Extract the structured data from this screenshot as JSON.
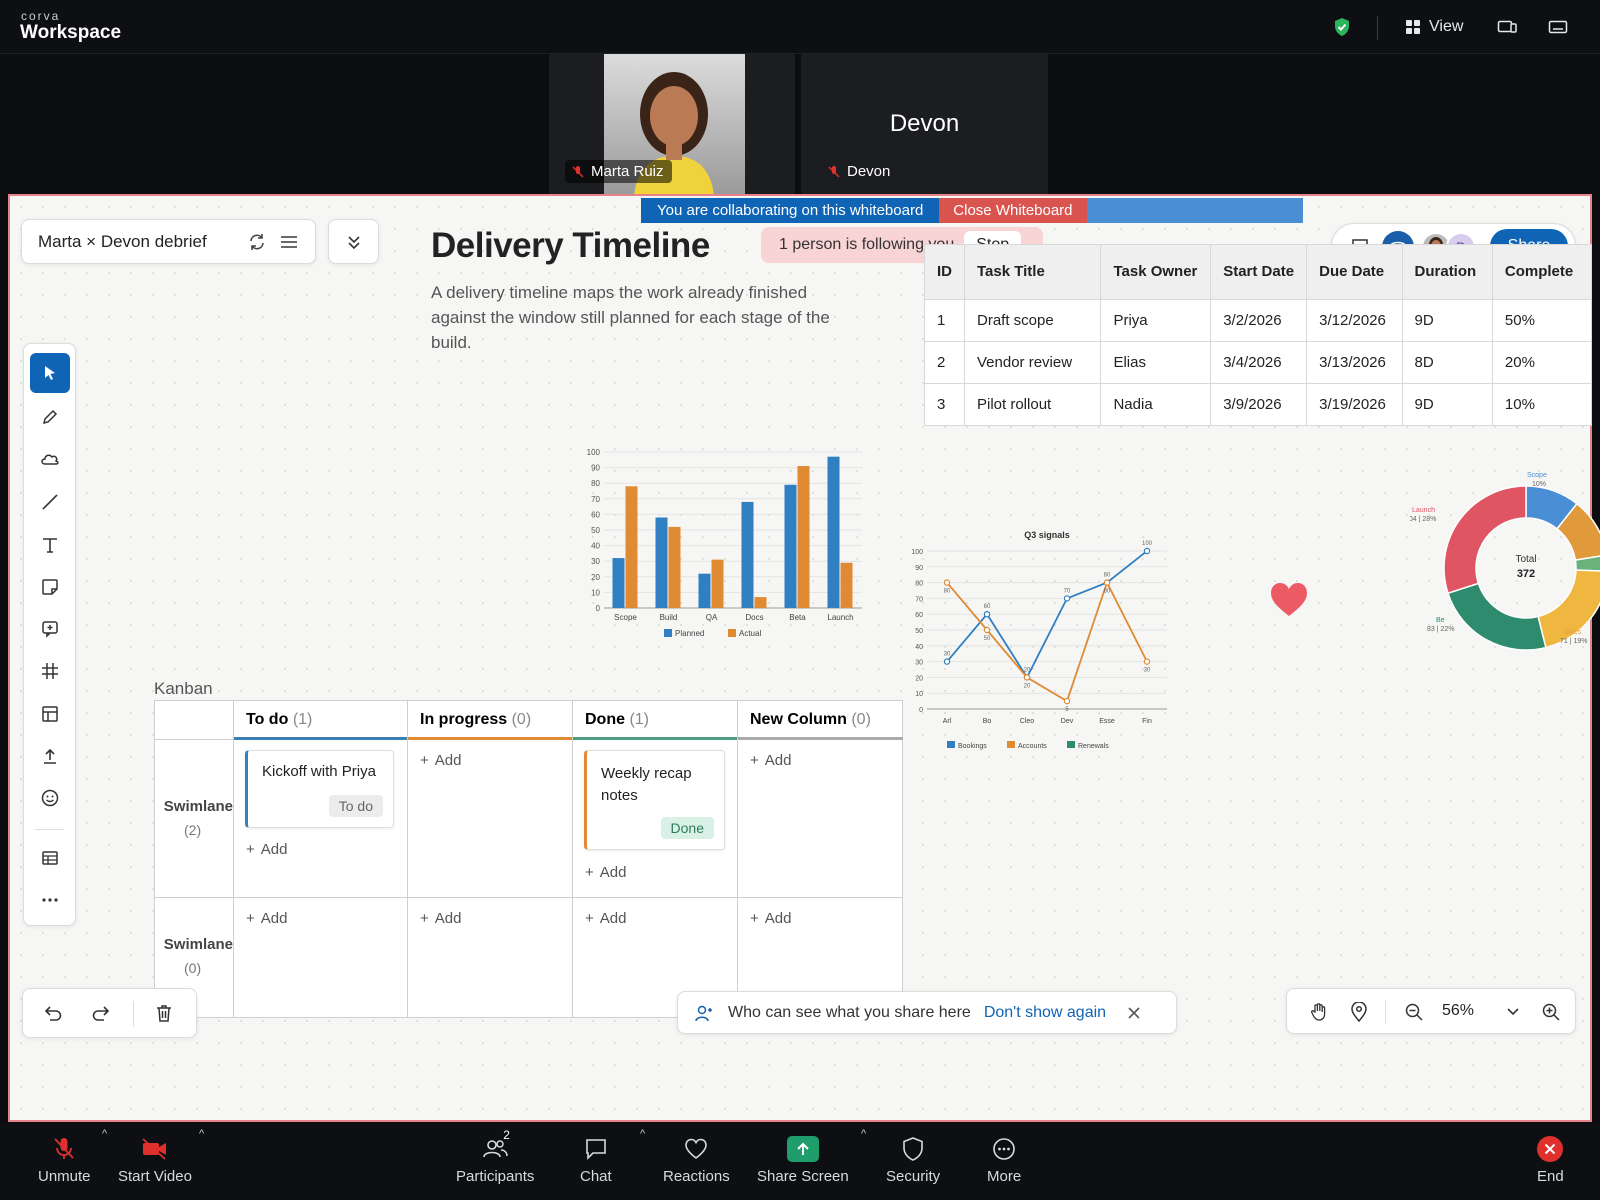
{
  "app": {
    "brand_small": "corva",
    "brand": "Workspace"
  },
  "topbar": {
    "view_label": "View"
  },
  "participants_video": [
    {
      "name": "Marta Ruiz"
    },
    {
      "name": "Devon",
      "display_name": "Devon"
    }
  ],
  "collab_bar": {
    "message": "You are collaborating on this whiteboard",
    "close_label": "Close Whiteboard"
  },
  "following": {
    "text": "1 person is following you",
    "stop_label": "Stop"
  },
  "board": {
    "title": "Marta × Devon debrief"
  },
  "collaborators": {
    "initial": "D",
    "share_label": "Share"
  },
  "doc": {
    "heading": "Delivery Timeline",
    "description": "A delivery timeline maps the work already finished against the window still planned for each stage of the build."
  },
  "task_table": {
    "headers": [
      "ID",
      "Task Title",
      "Task Owner",
      "Start Date",
      "Due Date",
      "Duration",
      "Complete"
    ],
    "rows": [
      [
        "1",
        "Draft scope",
        "Priya",
        "3/2/2026",
        "3/12/2026",
        "9D",
        "50%"
      ],
      [
        "2",
        "Vendor review",
        "Elias",
        "3/4/2026",
        "3/13/2026",
        "8D",
        "20%"
      ],
      [
        "3",
        "Pilot rollout",
        "Nadia",
        "3/9/2026",
        "3/19/2026",
        "9D",
        "10%"
      ]
    ]
  },
  "chart_data": [
    {
      "type": "bar",
      "title": "",
      "categories": [
        "Scope",
        "Build",
        "QA",
        "Docs",
        "Beta",
        "Launch"
      ],
      "series": [
        {
          "name": "Planned",
          "color": "#2f7fc1",
          "values": [
            32,
            58,
            22,
            68,
            79,
            97
          ]
        },
        {
          "name": "Actual",
          "color": "#e08a33",
          "values": [
            78,
            52,
            31,
            7,
            91,
            29
          ]
        }
      ],
      "ylim": [
        0,
        100
      ],
      "yticks": [
        0,
        10,
        20,
        30,
        40,
        50,
        60,
        70,
        80,
        90,
        100
      ],
      "legend": "bottom"
    },
    {
      "type": "line",
      "title": "Q3 signals",
      "categories": [
        "Arl",
        "Bo",
        "Cleo",
        "Dev",
        "Esse",
        "Fin"
      ],
      "series": [
        {
          "name": "Bookings",
          "color": "#2f7fc1",
          "values": [
            30,
            60,
            20,
            70,
            80,
            100
          ]
        },
        {
          "name": "Accounts",
          "color": "#e08a33",
          "values": [
            80,
            50,
            20,
            5,
            80,
            30
          ]
        }
      ],
      "legend_only": [
        {
          "name": "Renewals",
          "color": "#2e8b6e"
        }
      ],
      "ylim": [
        0,
        100
      ],
      "yticks": [
        0,
        10,
        20,
        30,
        40,
        50,
        60,
        70,
        80,
        90,
        100
      ],
      "legend": "bottom"
    },
    {
      "type": "pie",
      "title": "",
      "center_label": "Total",
      "center_value": "372",
      "total": 372,
      "slices": [
        {
          "name": "Scope",
          "value": 37,
          "color": "#4a8ed6"
        },
        {
          "name": "Build",
          "value": 41,
          "color": "#e09a3c"
        },
        {
          "name": "QA",
          "value": 11,
          "color": "#6ab27c"
        },
        {
          "name": "Docs",
          "value": 71,
          "color": "#f0b740"
        },
        {
          "name": "Beta",
          "value": 83,
          "color": "#2e8b6e"
        },
        {
          "name": "Launch",
          "value": 104,
          "color": "#e05563"
        }
      ],
      "visible_labels": [
        {
          "name": "Launch",
          "detail": "104 | 28%"
        },
        {
          "name": "Be",
          "detail": "83 | 22%"
        },
        {
          "name": "Docs",
          "detail": "71 | 19%"
        },
        {
          "name": "Scope",
          "detail": "10%"
        }
      ]
    }
  ],
  "kanban": {
    "title": "Kanban",
    "columns": [
      {
        "name": "To do",
        "count": "(1)",
        "color": "#3a7fb5"
      },
      {
        "name": "In progress",
        "count": "(0)",
        "color": "#e08a33"
      },
      {
        "name": "Done",
        "count": "(1)",
        "color": "#4e9e84"
      },
      {
        "name": "New Column",
        "count": "(0)",
        "color": "#aaaaaa"
      }
    ],
    "swimlanes": [
      {
        "name": "Swimlane",
        "count": "(2)"
      },
      {
        "name": "Swimlane",
        "count": "(0)"
      }
    ],
    "cards": [
      {
        "title": "Kickoff with Priya",
        "status": "To do"
      },
      {
        "title": "Weekly recap notes",
        "status": "Done"
      }
    ],
    "add_label": "Add"
  },
  "toast": {
    "text": "Who can see what you share here",
    "action": "Don't show again"
  },
  "zoom": {
    "value": "56%"
  },
  "bottom_bar": {
    "unmute": "Unmute",
    "start_video": "Start Video",
    "participants": "Participants",
    "participants_count": "2",
    "chat": "Chat",
    "reactions": "Reactions",
    "share_screen": "Share Screen",
    "security": "Security",
    "more": "More",
    "end": "End"
  },
  "colors": {
    "accent": "#0f64b5",
    "danger": "#d9534f",
    "whiteboard_border": "#e8828a",
    "share_green": "#1f9d6b",
    "end_red": "#e0302e",
    "heart": "#ec5a64"
  }
}
